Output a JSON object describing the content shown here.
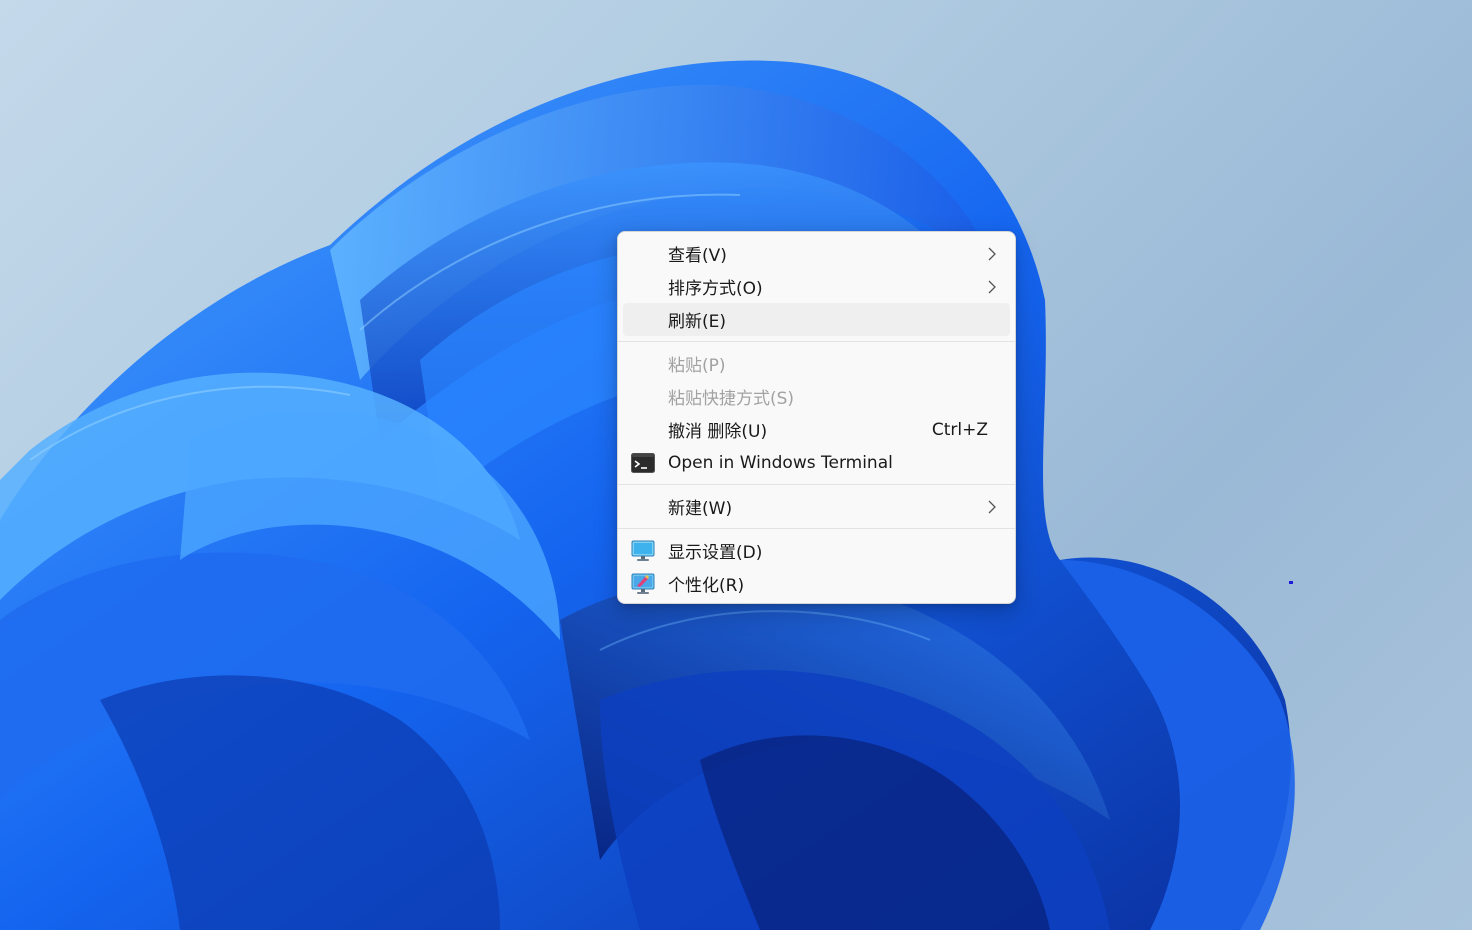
{
  "context_menu": {
    "items": [
      {
        "label": "查看(V)",
        "has_submenu": true,
        "disabled": false,
        "icon": ""
      },
      {
        "label": "排序方式(O)",
        "has_submenu": true,
        "disabled": false,
        "icon": ""
      },
      {
        "label": "刷新(E)",
        "has_submenu": false,
        "disabled": false,
        "icon": "",
        "hovered": true
      },
      {
        "label": "粘贴(P)",
        "has_submenu": false,
        "disabled": true,
        "icon": ""
      },
      {
        "label": "粘贴快捷方式(S)",
        "has_submenu": false,
        "disabled": true,
        "icon": ""
      },
      {
        "label": "撤消 删除(U)",
        "shortcut": "Ctrl+Z",
        "has_submenu": false,
        "disabled": false,
        "icon": ""
      },
      {
        "label": "Open in Windows Terminal",
        "has_submenu": false,
        "disabled": false,
        "icon": "terminal-icon"
      },
      {
        "label": "新建(W)",
        "has_submenu": true,
        "disabled": false,
        "icon": ""
      },
      {
        "label": "显示设置(D)",
        "has_submenu": false,
        "disabled": false,
        "icon": "display-settings-icon"
      },
      {
        "label": "个性化(R)",
        "has_submenu": false,
        "disabled": false,
        "icon": "personalize-icon"
      }
    ]
  },
  "colors": {
    "menu_background": "#f9f9f9",
    "menu_text": "#1a1a1a",
    "menu_disabled_text": "#a2a2a2",
    "hover_background": "#efefef",
    "wallpaper_background": "#b0cbe1",
    "wallpaper_bloom": "#1a5ce6"
  }
}
